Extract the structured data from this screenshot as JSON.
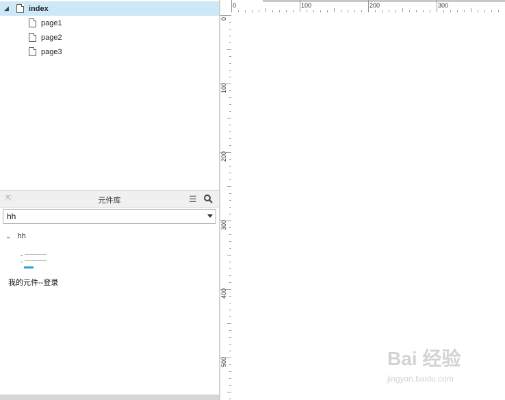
{
  "pages": {
    "items": [
      {
        "label": "index",
        "selected": true
      },
      {
        "label": "page1",
        "selected": false
      },
      {
        "label": "page2",
        "selected": false
      },
      {
        "label": "page3",
        "selected": false
      }
    ]
  },
  "library": {
    "title": "元件库",
    "selected_library": "hh",
    "group_label": "hh",
    "widget_label": "我的元件--登录",
    "accent_color": "#2a9fd6"
  },
  "ruler": {
    "top_labels": [
      "0",
      "100",
      "200",
      "300"
    ],
    "left_labels": [
      "0",
      "100",
      "200",
      "300",
      "400",
      "500"
    ]
  },
  "watermark": {
    "text": "Bai 经验",
    "url": "jingyan.baidu.com"
  },
  "icons": {
    "collapse": "triangle-down-icon",
    "page": "document-icon",
    "back": "arrow-up-left-icon",
    "menu": "hamburger-menu-icon",
    "search": "magnifier-icon",
    "dropdown": "caret-down-icon",
    "group": "chevron-down-icon"
  }
}
